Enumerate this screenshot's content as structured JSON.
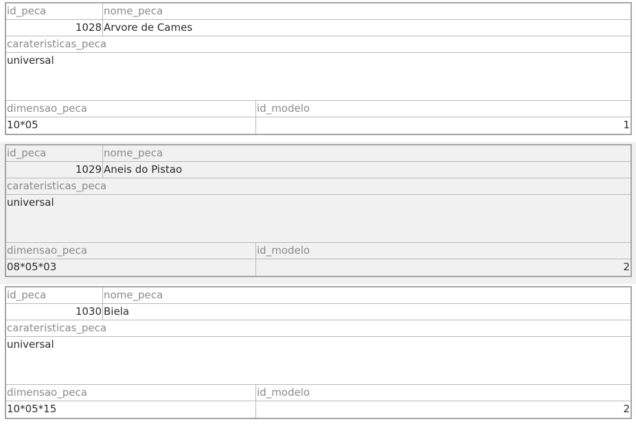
{
  "labels": {
    "id_peca": "id_peca",
    "nome_peca": "nome_peca",
    "carateristicas_peca": "carateristicas_peca",
    "dimensao_peca": "dimensao_peca",
    "id_modelo": "id_modelo"
  },
  "records": [
    {
      "id_peca": "1028",
      "nome_peca": "Arvore de Cames",
      "carateristicas_peca": "universal",
      "dimensao_peca": "10*05",
      "id_modelo": "1"
    },
    {
      "id_peca": "1029",
      "nome_peca": "Aneis do Pistao",
      "carateristicas_peca": "universal",
      "dimensao_peca": "08*05*03",
      "id_modelo": "2"
    },
    {
      "id_peca": "1030",
      "nome_peca": "Biela",
      "carateristicas_peca": "universal",
      "dimensao_peca": "10*05*15",
      "id_modelo": "2"
    }
  ]
}
